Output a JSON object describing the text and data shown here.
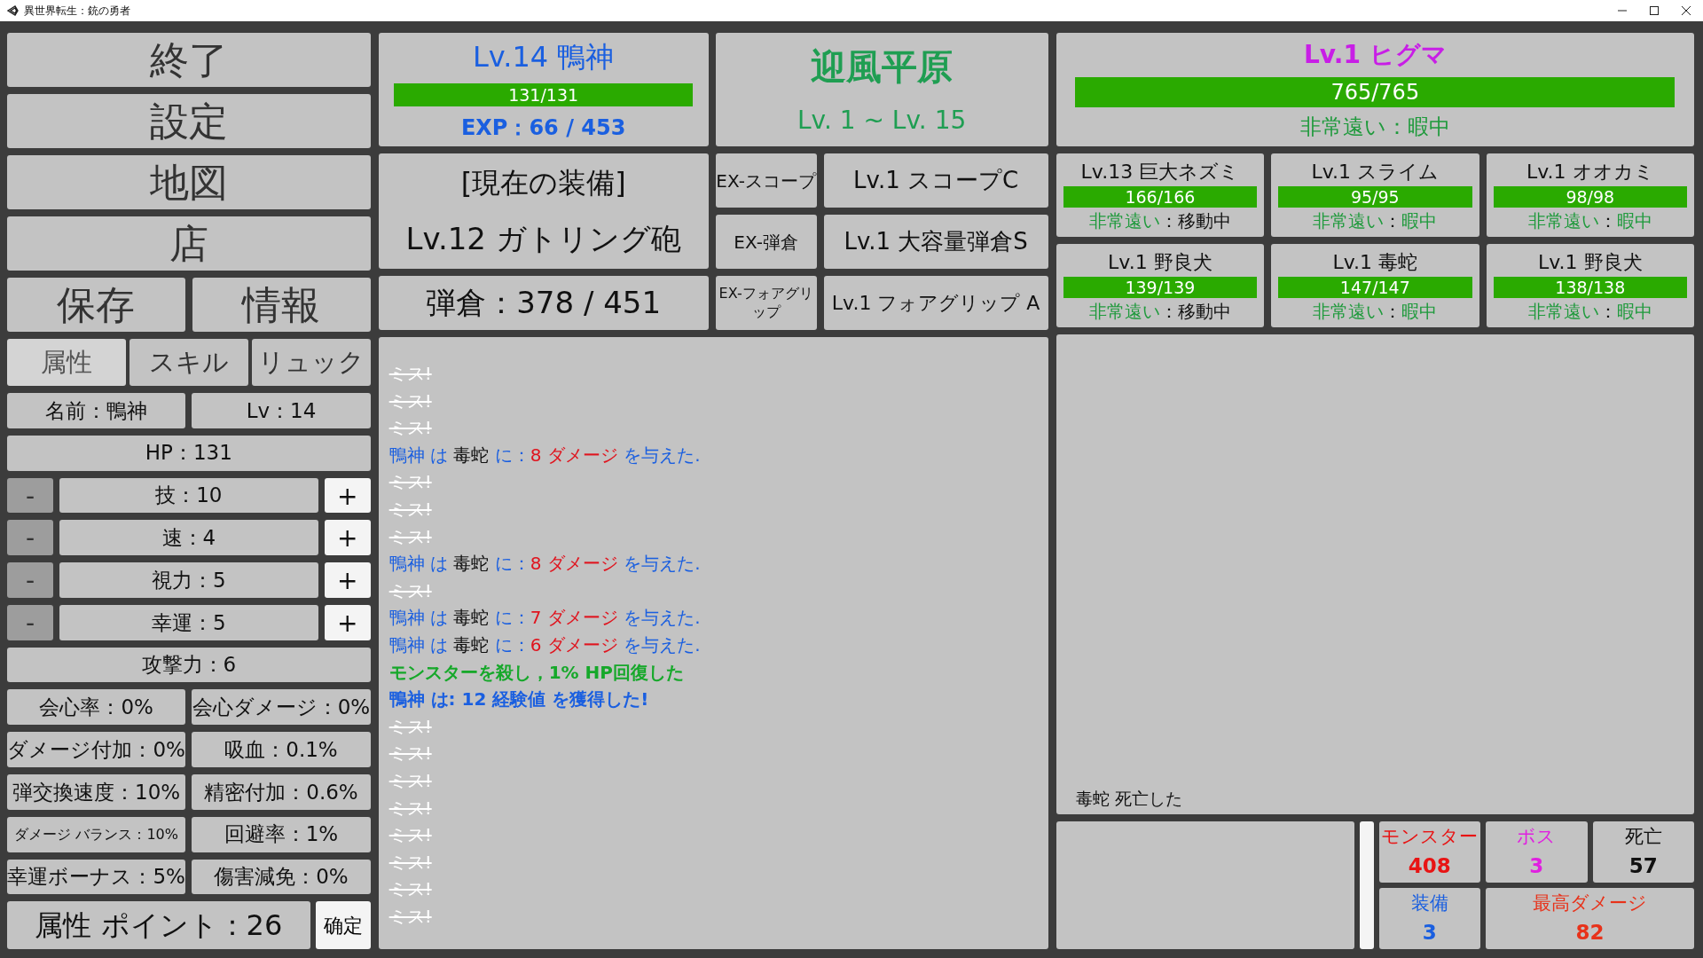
{
  "window": {
    "title": "異世界転生：銃の勇者"
  },
  "menu_buttons": [
    "終了",
    "設定",
    "地図",
    "店"
  ],
  "menu_pair": [
    "保存",
    "情報"
  ],
  "tabs": [
    {
      "label": "属性",
      "selected": true
    },
    {
      "label": "スキル",
      "selected": false
    },
    {
      "label": "リュック",
      "selected": false
    }
  ],
  "attributes": {
    "name": "名前：鴨神",
    "level": "Lv：14",
    "hp": "HP：131",
    "adjustable": [
      {
        "label": "技：10",
        "minus": {
          "label": "-",
          "disabled": true
        },
        "plus": {
          "label": "+",
          "disabled": false
        }
      },
      {
        "label": "速：4",
        "minus": {
          "label": "-",
          "disabled": true
        },
        "plus": {
          "label": "+",
          "disabled": false
        }
      },
      {
        "label": "視力：5",
        "minus": {
          "label": "-",
          "disabled": true
        },
        "plus": {
          "label": "+",
          "disabled": false
        }
      },
      {
        "label": "幸運：5",
        "minus": {
          "label": "-",
          "disabled": true
        },
        "plus": {
          "label": "+",
          "disabled": false
        }
      }
    ],
    "attack": "攻撃力：6",
    "stats": [
      {
        "text": "会心率：0%",
        "kind": "normal"
      },
      {
        "text": "会心ダメージ：0%",
        "kind": "normal"
      },
      {
        "text": "ダメージ付加：0%",
        "kind": "normal"
      },
      {
        "text": "吸血：0.1%",
        "kind": "normal"
      },
      {
        "text": "弾交換速度：10%",
        "kind": "normal"
      },
      {
        "text": "精密付加：0.6%",
        "kind": "normal"
      },
      {
        "text": "ダメージ バランス：10%",
        "kind": "small"
      },
      {
        "text": "回避率：1%",
        "kind": "normal"
      },
      {
        "text": "幸運ボーナス：5%",
        "kind": "normal"
      },
      {
        "text": "傷害減免：0%",
        "kind": "normal"
      }
    ],
    "points": "属性 ポイント：26",
    "confirm": "确定"
  },
  "player": {
    "name": "Lv.14 鴨神",
    "hp": {
      "text": "131/131",
      "level": 1
    },
    "exp": "EXP：66 / 453"
  },
  "area": {
    "name": "迎風平原",
    "levels": "Lv. 1 ~ Lv. 15"
  },
  "equipment": {
    "heading": "[現在の装備]",
    "weapon": "Lv.12 ガトリング砲",
    "magazine": "弾倉：378 / 451",
    "slots": [
      {
        "label": "EX-スコープ",
        "value": "Lv.1 スコープC",
        "kind": "normal"
      },
      {
        "label": "EX-弾倉",
        "value": "Lv.1 大容量弾倉S",
        "kind": "normal"
      },
      {
        "label": "EX-フォアグリップ",
        "value": "Lv.1 フォアグリップ A",
        "kind": "long"
      }
    ]
  },
  "log": [
    {
      "kind": "miss",
      "text": "ミス!"
    },
    {
      "kind": "miss",
      "text": "ミス!"
    },
    {
      "kind": "miss",
      "text": "ミス!"
    },
    {
      "kind": "attack",
      "actor": "鴨神",
      "particle": "は",
      "target": "毒蛇",
      "connector": "に：",
      "damage": "8 ダメージ",
      "ending": "を与えた."
    },
    {
      "kind": "miss",
      "text": "ミス!"
    },
    {
      "kind": "miss",
      "text": "ミス!"
    },
    {
      "kind": "miss",
      "text": "ミス!"
    },
    {
      "kind": "attack",
      "actor": "鴨神",
      "particle": "は",
      "target": "毒蛇",
      "connector": "に：",
      "damage": "8 ダメージ",
      "ending": "を与えた."
    },
    {
      "kind": "miss",
      "text": "ミス!"
    },
    {
      "kind": "attack",
      "actor": "鴨神",
      "particle": "は",
      "target": "毒蛇",
      "connector": "に：",
      "damage": "7 ダメージ",
      "ending": "を与えた."
    },
    {
      "kind": "attack",
      "actor": "鴨神",
      "particle": "は",
      "target": "毒蛇",
      "connector": "に：",
      "damage": "6 ダメージ",
      "ending": "を与えた."
    },
    {
      "kind": "heal",
      "text": "モンスターを殺し，1% HP回復した"
    },
    {
      "kind": "exp",
      "text": "鴨神 は: **12 経験値** を獲得した!"
    },
    {
      "kind": "miss",
      "text": "ミス!"
    },
    {
      "kind": "miss",
      "text": "ミス!"
    },
    {
      "kind": "miss",
      "text": "ミス!"
    },
    {
      "kind": "miss",
      "text": "ミス!"
    },
    {
      "kind": "miss",
      "text": "ミス!"
    },
    {
      "kind": "miss",
      "text": "ミス!"
    },
    {
      "kind": "miss",
      "text": "ミス!"
    },
    {
      "kind": "miss",
      "text": "ミス!"
    }
  ],
  "boss": {
    "name": "Lv.1 ヒグマ",
    "hp": {
      "text": "765/765",
      "level": 1
    },
    "status": "非常遠い：暇中"
  },
  "monsters": [
    {
      "name": "Lv.13 巨大ネズミ",
      "hp": {
        "text": "166/166",
        "level": 1
      },
      "distance": "非常遠い",
      "separator": "：",
      "activity": "移動中",
      "moving": true
    },
    {
      "name": "Lv.1 スライム",
      "hp": {
        "text": "95/95",
        "level": 1
      },
      "distance": "非常遠い",
      "separator": "：",
      "activity": "暇中",
      "moving": false
    },
    {
      "name": "Lv.1 オオカミ",
      "hp": {
        "text": "98/98",
        "level": 1
      },
      "distance": "非常遠い",
      "separator": "：",
      "activity": "暇中",
      "moving": false
    },
    {
      "name": "Lv.1 野良犬",
      "hp": {
        "text": "139/139",
        "level": 1
      },
      "distance": "非常遠い",
      "separator": "：",
      "activity": "移動中",
      "moving": true
    },
    {
      "name": "Lv.1 毒蛇",
      "hp": {
        "text": "147/147",
        "level": 1
      },
      "distance": "非常遠い",
      "separator": "：",
      "activity": "暇中",
      "moving": false
    },
    {
      "name": "Lv.1 野良犬",
      "hp": {
        "text": "138/138",
        "level": 1
      },
      "distance": "非常遠い",
      "separator": "：",
      "activity": "暇中",
      "moving": false
    }
  ],
  "battle": {
    "message": "毒蛇 死亡した"
  },
  "counters": [
    {
      "label": "モンスター",
      "value": "408",
      "color": "#e81414",
      "wide": false
    },
    {
      "label": "ボス",
      "value": "3",
      "color": "#e020e0",
      "wide": false
    },
    {
      "label": "死亡",
      "value": "57",
      "color": "#111111",
      "wide": false
    },
    {
      "label": "装備",
      "value": "3",
      "color": "#1a5fe0",
      "wide": false
    },
    {
      "label": "最高ダメージ",
      "value": "82",
      "color": "#e8321a",
      "wide": true
    }
  ]
}
